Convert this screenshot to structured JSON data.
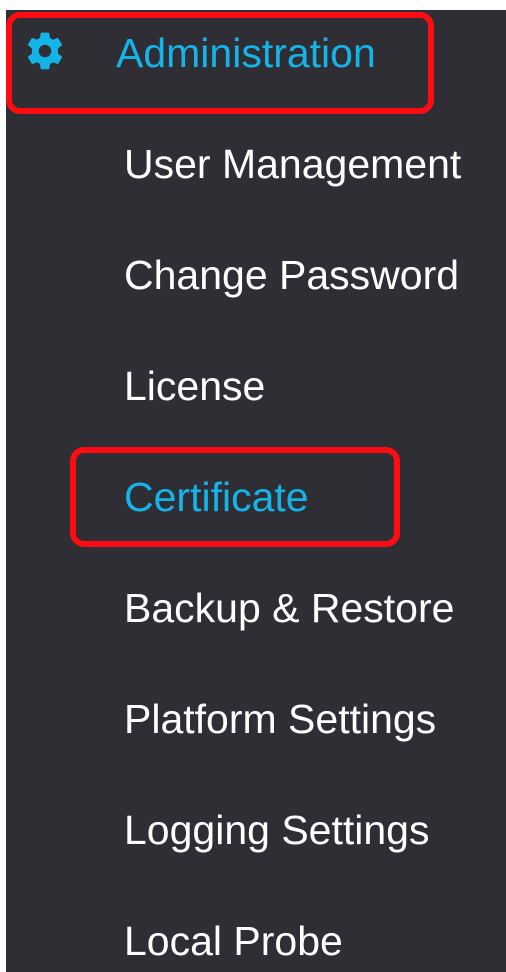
{
  "sidebar": {
    "section": {
      "icon": "gear-icon",
      "label": "Administration",
      "highlighted": true
    },
    "items": [
      {
        "label": "User Management",
        "active": false
      },
      {
        "label": "Change Password",
        "active": false
      },
      {
        "label": "License",
        "active": false
      },
      {
        "label": "Certificate",
        "active": true,
        "highlighted": true
      },
      {
        "label": "Backup & Restore",
        "active": false
      },
      {
        "label": "Platform Settings",
        "active": false
      },
      {
        "label": "Logging Settings",
        "active": false
      },
      {
        "label": "Local Probe",
        "active": false
      }
    ]
  },
  "colors": {
    "background": "#2f2e35",
    "accent": "#14b4e8",
    "text": "#ffffff",
    "highlight_box": "#ff0b12"
  }
}
